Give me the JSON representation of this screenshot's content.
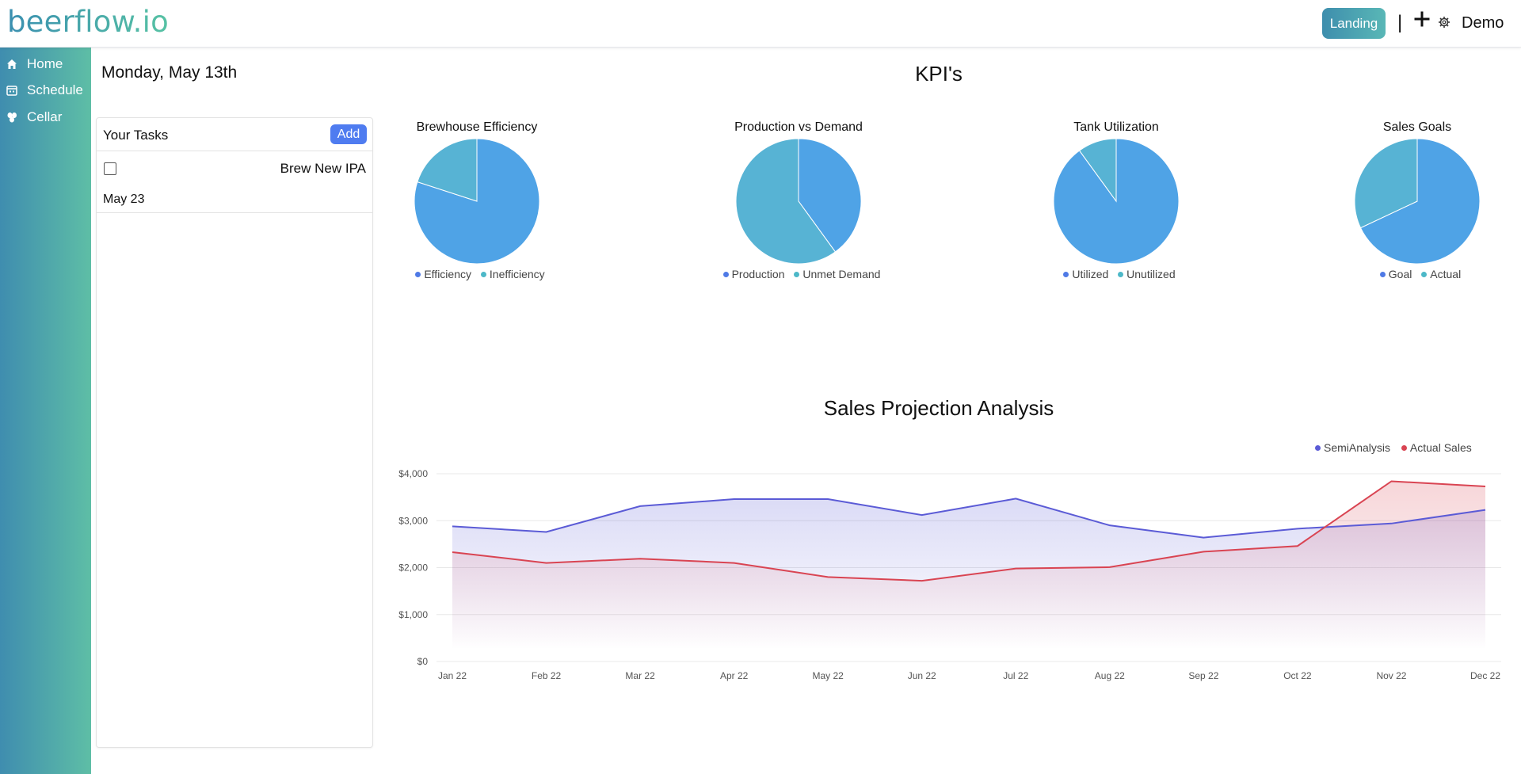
{
  "header": {
    "logo": "beerflow.io",
    "landing_label": "Landing",
    "separator": "|",
    "user": "Demo"
  },
  "sidebar": {
    "items": [
      {
        "label": "Home",
        "icon": "home-icon"
      },
      {
        "label": "Schedule",
        "icon": "calendar-icon"
      },
      {
        "label": "Cellar",
        "icon": "barrels-icon"
      }
    ]
  },
  "date": "Monday, May 13th",
  "tasks": {
    "title": "Your Tasks",
    "add_label": "Add",
    "items": [
      {
        "name": "Brew New IPA",
        "date": "May 23",
        "checked": false
      }
    ]
  },
  "kpi": {
    "title": "KPI's",
    "colors": {
      "primary": "#4fa3e6",
      "secondary": "#57b3d4",
      "dot_primary": "#4f7ae6",
      "dot_secondary": "#4db8c8"
    }
  },
  "chart_data": [
    {
      "type": "pie",
      "title": "Brewhouse Efficiency",
      "labels": [
        "Efficiency",
        "Inefficiency"
      ],
      "values": [
        80,
        20
      ]
    },
    {
      "type": "pie",
      "title": "Production vs Demand",
      "labels": [
        "Production",
        "Unmet Demand"
      ],
      "values": [
        40,
        60
      ]
    },
    {
      "type": "pie",
      "title": "Tank Utilization",
      "labels": [
        "Utilized",
        "Unutilized"
      ],
      "values": [
        90,
        10
      ]
    },
    {
      "type": "pie",
      "title": "Sales Goals",
      "labels": [
        "Goal",
        "Actual"
      ],
      "values": [
        68,
        32
      ]
    },
    {
      "type": "area",
      "title": "Sales Projection Analysis",
      "categories": [
        "Jan 22",
        "Feb 22",
        "Mar 22",
        "Apr 22",
        "May 22",
        "Jun 22",
        "Jul 22",
        "Aug 22",
        "Sep 22",
        "Oct 22",
        "Nov 22",
        "Dec 22"
      ],
      "series": [
        {
          "name": "SemiAnalysis",
          "color": "#5b5bd6",
          "values": [
            2880,
            2760,
            3310,
            3460,
            3460,
            3120,
            3470,
            2900,
            2640,
            2830,
            2940,
            3230
          ]
        },
        {
          "name": "Actual Sales",
          "color": "#d94452",
          "values": [
            2330,
            2100,
            2190,
            2100,
            1800,
            1720,
            1980,
            2010,
            2340,
            2460,
            3840,
            3730
          ]
        }
      ],
      "yticks": [
        "$0",
        "$1,000",
        "$2,000",
        "$3,000",
        "$4,000"
      ],
      "ylim": [
        0,
        4000
      ],
      "legend": "top-right",
      "grid": true
    }
  ]
}
